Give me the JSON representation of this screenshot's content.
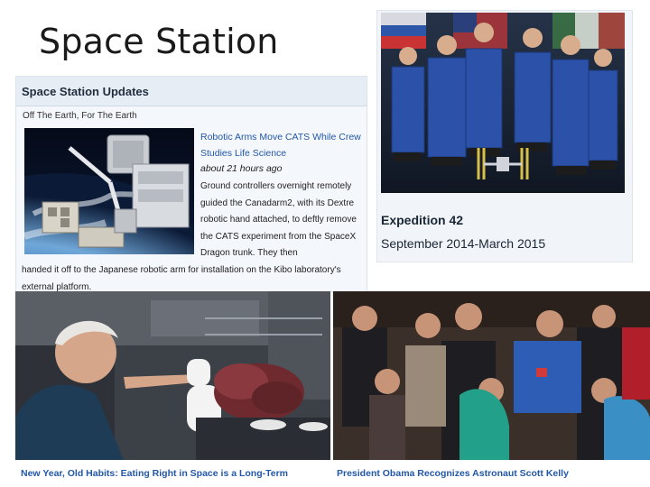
{
  "slide": {
    "title": "Space Station"
  },
  "updates": {
    "title": "Space Station Updates",
    "subtitle": "Off The Earth, For The Earth",
    "story_title": "Robotic Arms Move CATS While Crew Studies Life Science",
    "story_time": "about 21 hours ago",
    "story_body": "Ground controllers overnight remotely guided the Canadarm2, with its Dextre robotic hand attached, to deftly remove the CATS experiment from the SpaceX Dragon trunk. They then",
    "story_tail": "handed it off to the Japanese robotic arm for installation on the Kibo laboratory's external platform."
  },
  "expedition": {
    "title": "Expedition 42",
    "dates": "September 2014-March 2015"
  },
  "panel3": {
    "caption": "New Year, Old Habits: Eating Right in Space is a Long-Term Resolution"
  },
  "panel4": {
    "caption": "President Obama Recognizes Astronaut Scott Kelly"
  }
}
